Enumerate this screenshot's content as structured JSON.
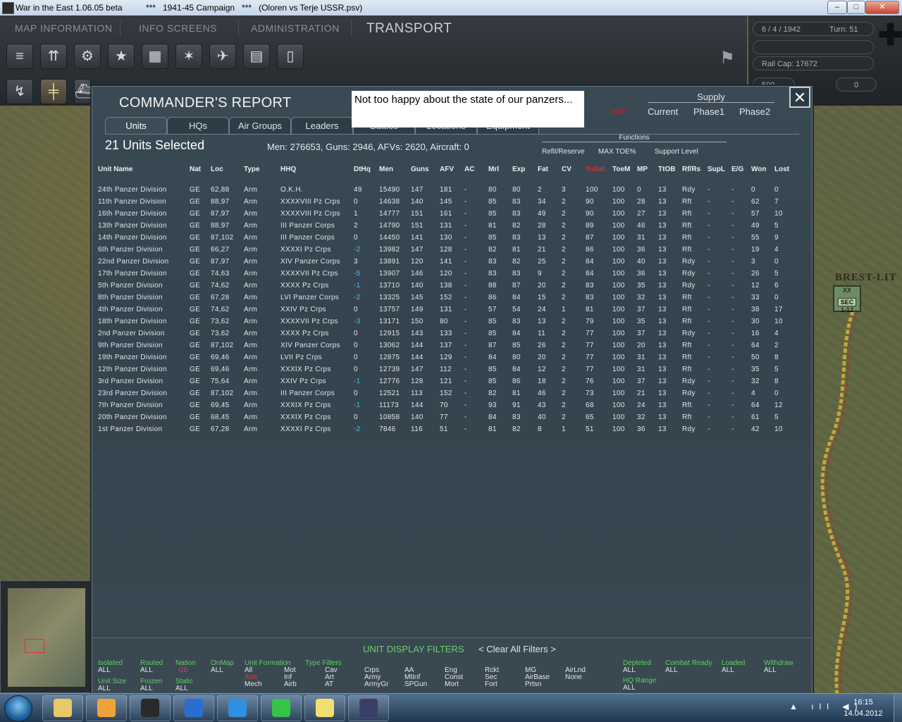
{
  "window": {
    "title": "War in the East 1.06.05 beta          ***   1941-45 Campaign   ***   (Oloren vs Terje USSR.psv)",
    "minimize": "–",
    "maximize": "□",
    "close": "✕"
  },
  "menu": {
    "map_information": "MAP INFORMATION",
    "info_screens": "INFO SCREENS",
    "administration": "ADMINISTRATION",
    "transport": "TRANSPORT"
  },
  "toolbar_icons": [
    "tank-icon",
    "movement-icon",
    "gear-icon",
    "star-icon",
    "grid-weather-icon",
    "satellite-icon",
    "air-icon",
    "rail-icon",
    "phone-icon"
  ],
  "info": {
    "date": "6 / 4 / 1942",
    "turn": "Turn: 51",
    "rail_cap": "Rail Cap: 17672",
    "value_500": "500",
    "value_0": "0"
  },
  "map": {
    "city_label": "BREST-LIT",
    "unit_xx": "XX",
    "unit_name": "SEC",
    "unit_strength": "1-12"
  },
  "dialog": {
    "title": "COMMANDER'S REPORT",
    "note": "Not too happy about the state of our panzers...",
    "close": "✕",
    "tabs": [
      "Units",
      "HQs",
      "Air Groups",
      "Leaders",
      "Battles",
      "Locations",
      "Equipment"
    ],
    "supply_header": "Supply",
    "supply_options": {
      "max": "Max*",
      "current": "Current",
      "phase1": "Phase1",
      "phase2": "Phase2"
    },
    "units_selected": "21 Units Selected",
    "summary": "Men: 276653, Guns: 2946, AFVs: 2620, Aircraft: 0",
    "functions_header": "Functions",
    "functions": {
      "refit": "Refit/Reserve",
      "max_toe": "MAX TOE%",
      "support": "Support Level"
    },
    "columns": [
      "Unit Name",
      "Nat",
      "Loc",
      "Type",
      "HHQ",
      "DtHq",
      "Men",
      "Guns",
      "AFV",
      "AC",
      "Mrl",
      "Exp",
      "Fat",
      "CV",
      "ToSat",
      "ToeM",
      "MP",
      "TtOB",
      "Rf/Rs",
      "SupL",
      "E/G",
      "Won",
      "Lost"
    ],
    "rows": [
      [
        "24th Panzer Division",
        "GE",
        "62,88",
        "Arm",
        "O.K.H.",
        "49",
        "15490",
        "147",
        "181",
        "-",
        "80",
        "80",
        "2",
        "3",
        "100",
        "100",
        "0",
        "13",
        "Rdy",
        "-",
        "-",
        "0",
        "0"
      ],
      [
        "11th Panzer Division",
        "GE",
        "88,97",
        "Arm",
        "XXXXVIII Pz Crps",
        "0",
        "14638",
        "140",
        "145",
        "-",
        "85",
        "83",
        "34",
        "2",
        "90",
        "100",
        "28",
        "13",
        "Rft",
        "-",
        "-",
        "62",
        "7"
      ],
      [
        "16th Panzer Division",
        "GE",
        "87,97",
        "Arm",
        "XXXXVIII Pz Crps",
        "1",
        "14777",
        "151",
        "161",
        "-",
        "85",
        "83",
        "49",
        "2",
        "90",
        "100",
        "27",
        "13",
        "Rft",
        "-",
        "-",
        "57",
        "10"
      ],
      [
        "13th Panzer Division",
        "GE",
        "88,97",
        "Arm",
        "III Panzer Corps",
        "2",
        "14790",
        "151",
        "131",
        "-",
        "81",
        "82",
        "28",
        "2",
        "89",
        "100",
        "46",
        "13",
        "Rft",
        "-",
        "-",
        "49",
        "5"
      ],
      [
        "14th Panzer Division",
        "GE",
        "87,102",
        "Arm",
        "III Panzer Corps",
        "0",
        "14450",
        "141",
        "130",
        "-",
        "85",
        "83",
        "13",
        "2",
        "87",
        "100",
        "31",
        "13",
        "Rft",
        "-",
        "-",
        "55",
        "9"
      ],
      [
        "6th Panzer Division",
        "GE",
        "66,27",
        "Arm",
        "XXXXI Pz Crps",
        "-2",
        "13982",
        "147",
        "128",
        "-",
        "82",
        "81",
        "21",
        "2",
        "86",
        "100",
        "36",
        "13",
        "Rft",
        "-",
        "-",
        "19",
        "4"
      ],
      [
        "22nd Panzer Division",
        "GE",
        "87,97",
        "Arm",
        "XIV Panzer Corps",
        "3",
        "13891",
        "120",
        "141",
        "-",
        "83",
        "82",
        "25",
        "2",
        "84",
        "100",
        "40",
        "13",
        "Rdy",
        "-",
        "-",
        "3",
        "0"
      ],
      [
        "17th Panzer Division",
        "GE",
        "74,63",
        "Arm",
        "XXXXVII Pz Crps",
        "-5",
        "13907",
        "146",
        "120",
        "-",
        "83",
        "83",
        "9",
        "2",
        "84",
        "100",
        "36",
        "13",
        "Rdy",
        "-",
        "-",
        "26",
        "5"
      ],
      [
        "5th Panzer Division",
        "GE",
        "74,62",
        "Arm",
        "XXXX Pz Crps",
        "-1",
        "13710",
        "140",
        "138",
        "-",
        "88",
        "87",
        "20",
        "2",
        "83",
        "100",
        "35",
        "13",
        "Rdy",
        "-",
        "-",
        "12",
        "6"
      ],
      [
        "8th Panzer Division",
        "GE",
        "67,28",
        "Arm",
        "LVI Panzer Corps",
        "-2",
        "13325",
        "145",
        "152",
        "-",
        "86",
        "84",
        "15",
        "2",
        "83",
        "100",
        "32",
        "13",
        "Rft",
        "-",
        "-",
        "33",
        "0"
      ],
      [
        "4th Panzer Division",
        "GE",
        "74,62",
        "Arm",
        "XXIV Pz Crps",
        "0",
        "13757",
        "149",
        "131",
        "-",
        "57",
        "54",
        "24",
        "1",
        "81",
        "100",
        "37",
        "13",
        "Rft",
        "-",
        "-",
        "38",
        "17"
      ],
      [
        "18th Panzer Division",
        "GE",
        "73,62",
        "Arm",
        "XXXXVII Pz Crps",
        "-3",
        "13171",
        "150",
        "80",
        "-",
        "85",
        "83",
        "13",
        "2",
        "79",
        "100",
        "35",
        "13",
        "Rft",
        "-",
        "-",
        "30",
        "10"
      ],
      [
        "2nd Panzer Division",
        "GE",
        "73,62",
        "Arm",
        "XXXX Pz Crps",
        "0",
        "12915",
        "143",
        "133",
        "-",
        "85",
        "84",
        "11",
        "2",
        "77",
        "100",
        "37",
        "13",
        "Rdy",
        "-",
        "-",
        "16",
        "4"
      ],
      [
        "9th Panzer Division",
        "GE",
        "87,102",
        "Arm",
        "XIV Panzer Corps",
        "0",
        "13062",
        "144",
        "137",
        "-",
        "87",
        "85",
        "26",
        "2",
        "77",
        "100",
        "20",
        "13",
        "Rft",
        "-",
        "-",
        "64",
        "2"
      ],
      [
        "19th Panzer Division",
        "GE",
        "69,46",
        "Arm",
        "LVII Pz Crps",
        "0",
        "12875",
        "144",
        "129",
        "-",
        "84",
        "80",
        "20",
        "2",
        "77",
        "100",
        "31",
        "13",
        "Rft",
        "-",
        "-",
        "50",
        "8"
      ],
      [
        "12th Panzer Division",
        "GE",
        "69,46",
        "Arm",
        "XXXIX Pz Crps",
        "0",
        "12739",
        "147",
        "112",
        "-",
        "85",
        "84",
        "12",
        "2",
        "77",
        "100",
        "31",
        "13",
        "Rft",
        "-",
        "-",
        "35",
        "5"
      ],
      [
        "3rd Panzer Division",
        "GE",
        "75,64",
        "Arm",
        "XXIV Pz Crps",
        "-1",
        "12776",
        "128",
        "121",
        "-",
        "85",
        "86",
        "18",
        "2",
        "76",
        "100",
        "37",
        "13",
        "Rdy",
        "-",
        "-",
        "32",
        "8"
      ],
      [
        "23rd Panzer Division",
        "GE",
        "87,102",
        "Arm",
        "III Panzer Corps",
        "0",
        "12521",
        "113",
        "152",
        "-",
        "82",
        "81",
        "46",
        "2",
        "73",
        "100",
        "21",
        "13",
        "Rdy",
        "-",
        "-",
        "4",
        "0"
      ],
      [
        "7th Panzer Division",
        "GE",
        "69,45",
        "Arm",
        "XXXIX Pz Crps",
        "-1",
        "11173",
        "144",
        "70",
        "-",
        "93",
        "91",
        "43",
        "2",
        "68",
        "100",
        "24",
        "13",
        "Rft",
        "-",
        "-",
        "64",
        "12"
      ],
      [
        "20th Panzer Division",
        "GE",
        "68,45",
        "Arm",
        "XXXIX Pz Crps",
        "0",
        "10858",
        "140",
        "77",
        "-",
        "84",
        "83",
        "40",
        "2",
        "65",
        "100",
        "32",
        "13",
        "Rft",
        "-",
        "-",
        "61",
        "5"
      ],
      [
        "1st Panzer Division",
        "GE",
        "67,28",
        "Arm",
        "XXXXI Pz Crps",
        "-2",
        "7846",
        "116",
        "51",
        "-",
        "81",
        "82",
        "8",
        "1",
        "51",
        "100",
        "36",
        "13",
        "Rdy",
        "-",
        "-",
        "42",
        "10"
      ]
    ],
    "filters": {
      "title": "UNIT DISPLAY FILTERS",
      "clear": "< Clear All Filters >",
      "isolated": "Isolated",
      "isolated_v": "ALL",
      "routed": "Routed",
      "routed_v": "ALL",
      "nation": "Nation",
      "nation_v": "GE",
      "onmap": "OnMap",
      "onmap_v": "ALL",
      "unit_formation": "Unit  Formation",
      "uf_all": "All",
      "uf_arm": "Arm",
      "uf_mech": "Mech",
      "type_filters": "Type   Filters",
      "mot": "Mot",
      "inf": "Inf",
      "airb": "Airb",
      "cav": "Cav",
      "art": "Art",
      "at": "AT",
      "crps": "Crps",
      "army": "Army",
      "armygr": "ArmyGr",
      "aa": "AA",
      "mtinf": "MtInf",
      "spgun": "SPGun",
      "eng": "Eng",
      "const": "Const",
      "mort": "Mort",
      "rckt": "Rckt",
      "sec": "Sec",
      "fort": "Fort",
      "mg": "MG",
      "airbase": "AirBase",
      "prtsn": "Prtsn",
      "airlnd": "AirLnd",
      "none": "None",
      "unit_size": "Unit Size",
      "unit_size_v": "ALL",
      "frozen": "Frozen",
      "frozen_v": "ALL",
      "static": "Static",
      "static_v": "ALL",
      "depleted": "Depleted",
      "depleted_v": "ALL",
      "combat_ready": "Combat Ready",
      "combat_ready_v": "ALL",
      "loaded": "Loaded",
      "loaded_v": "ALL",
      "withdraw": "Withdraw",
      "withdraw_v": "ALL",
      "hq_range": "HQ Range",
      "hq_range_v": "ALL"
    }
  },
  "taskbar": {
    "time": "16:15",
    "date": "14.04.2012",
    "apps": [
      "explorer-icon",
      "media-player-icon",
      "hp-icon",
      "checkmark-app-icon",
      "internet-explorer-icon",
      "spotify-icon",
      "sticky-notes-icon",
      "war-in-the-east-icon"
    ],
    "tray": "▲ ıll ◀)"
  }
}
